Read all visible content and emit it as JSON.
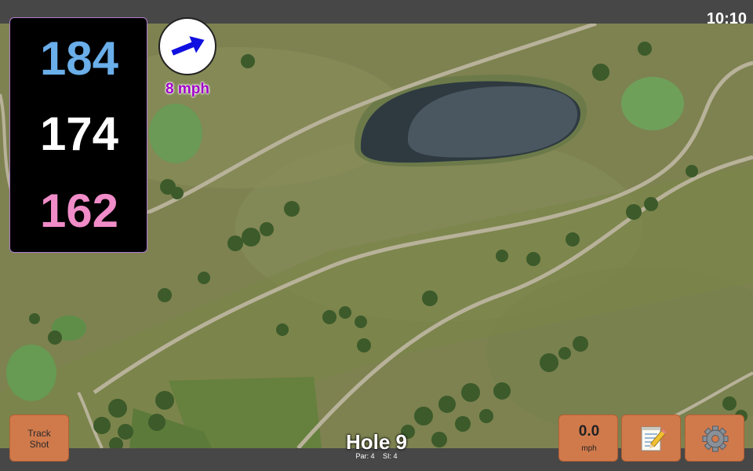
{
  "status": {
    "time": "10:10"
  },
  "distances": {
    "back": "184",
    "middle": "174",
    "front": "162",
    "colors": {
      "back": "#6aaeea",
      "middle": "#ffffff",
      "front": "#f08cc8"
    }
  },
  "wind": {
    "speed": "8 mph",
    "speed_color": "#a000c8",
    "arrow_color": "#1010e0",
    "arrow_icon": "wind-direction-arrow-icon"
  },
  "hole": {
    "title": "Hole 9",
    "par": "Par: 4",
    "si": "SI: 4"
  },
  "buttons": {
    "track_shot_line1": "Track",
    "track_shot_line2": "Shot",
    "speed_value": "0.0",
    "speed_unit": "mph",
    "notes_icon": "notepad-icon",
    "settings_icon": "gear-icon"
  },
  "theme": {
    "button_color": "#d07a4c",
    "panel_border": "#b07cd0"
  }
}
